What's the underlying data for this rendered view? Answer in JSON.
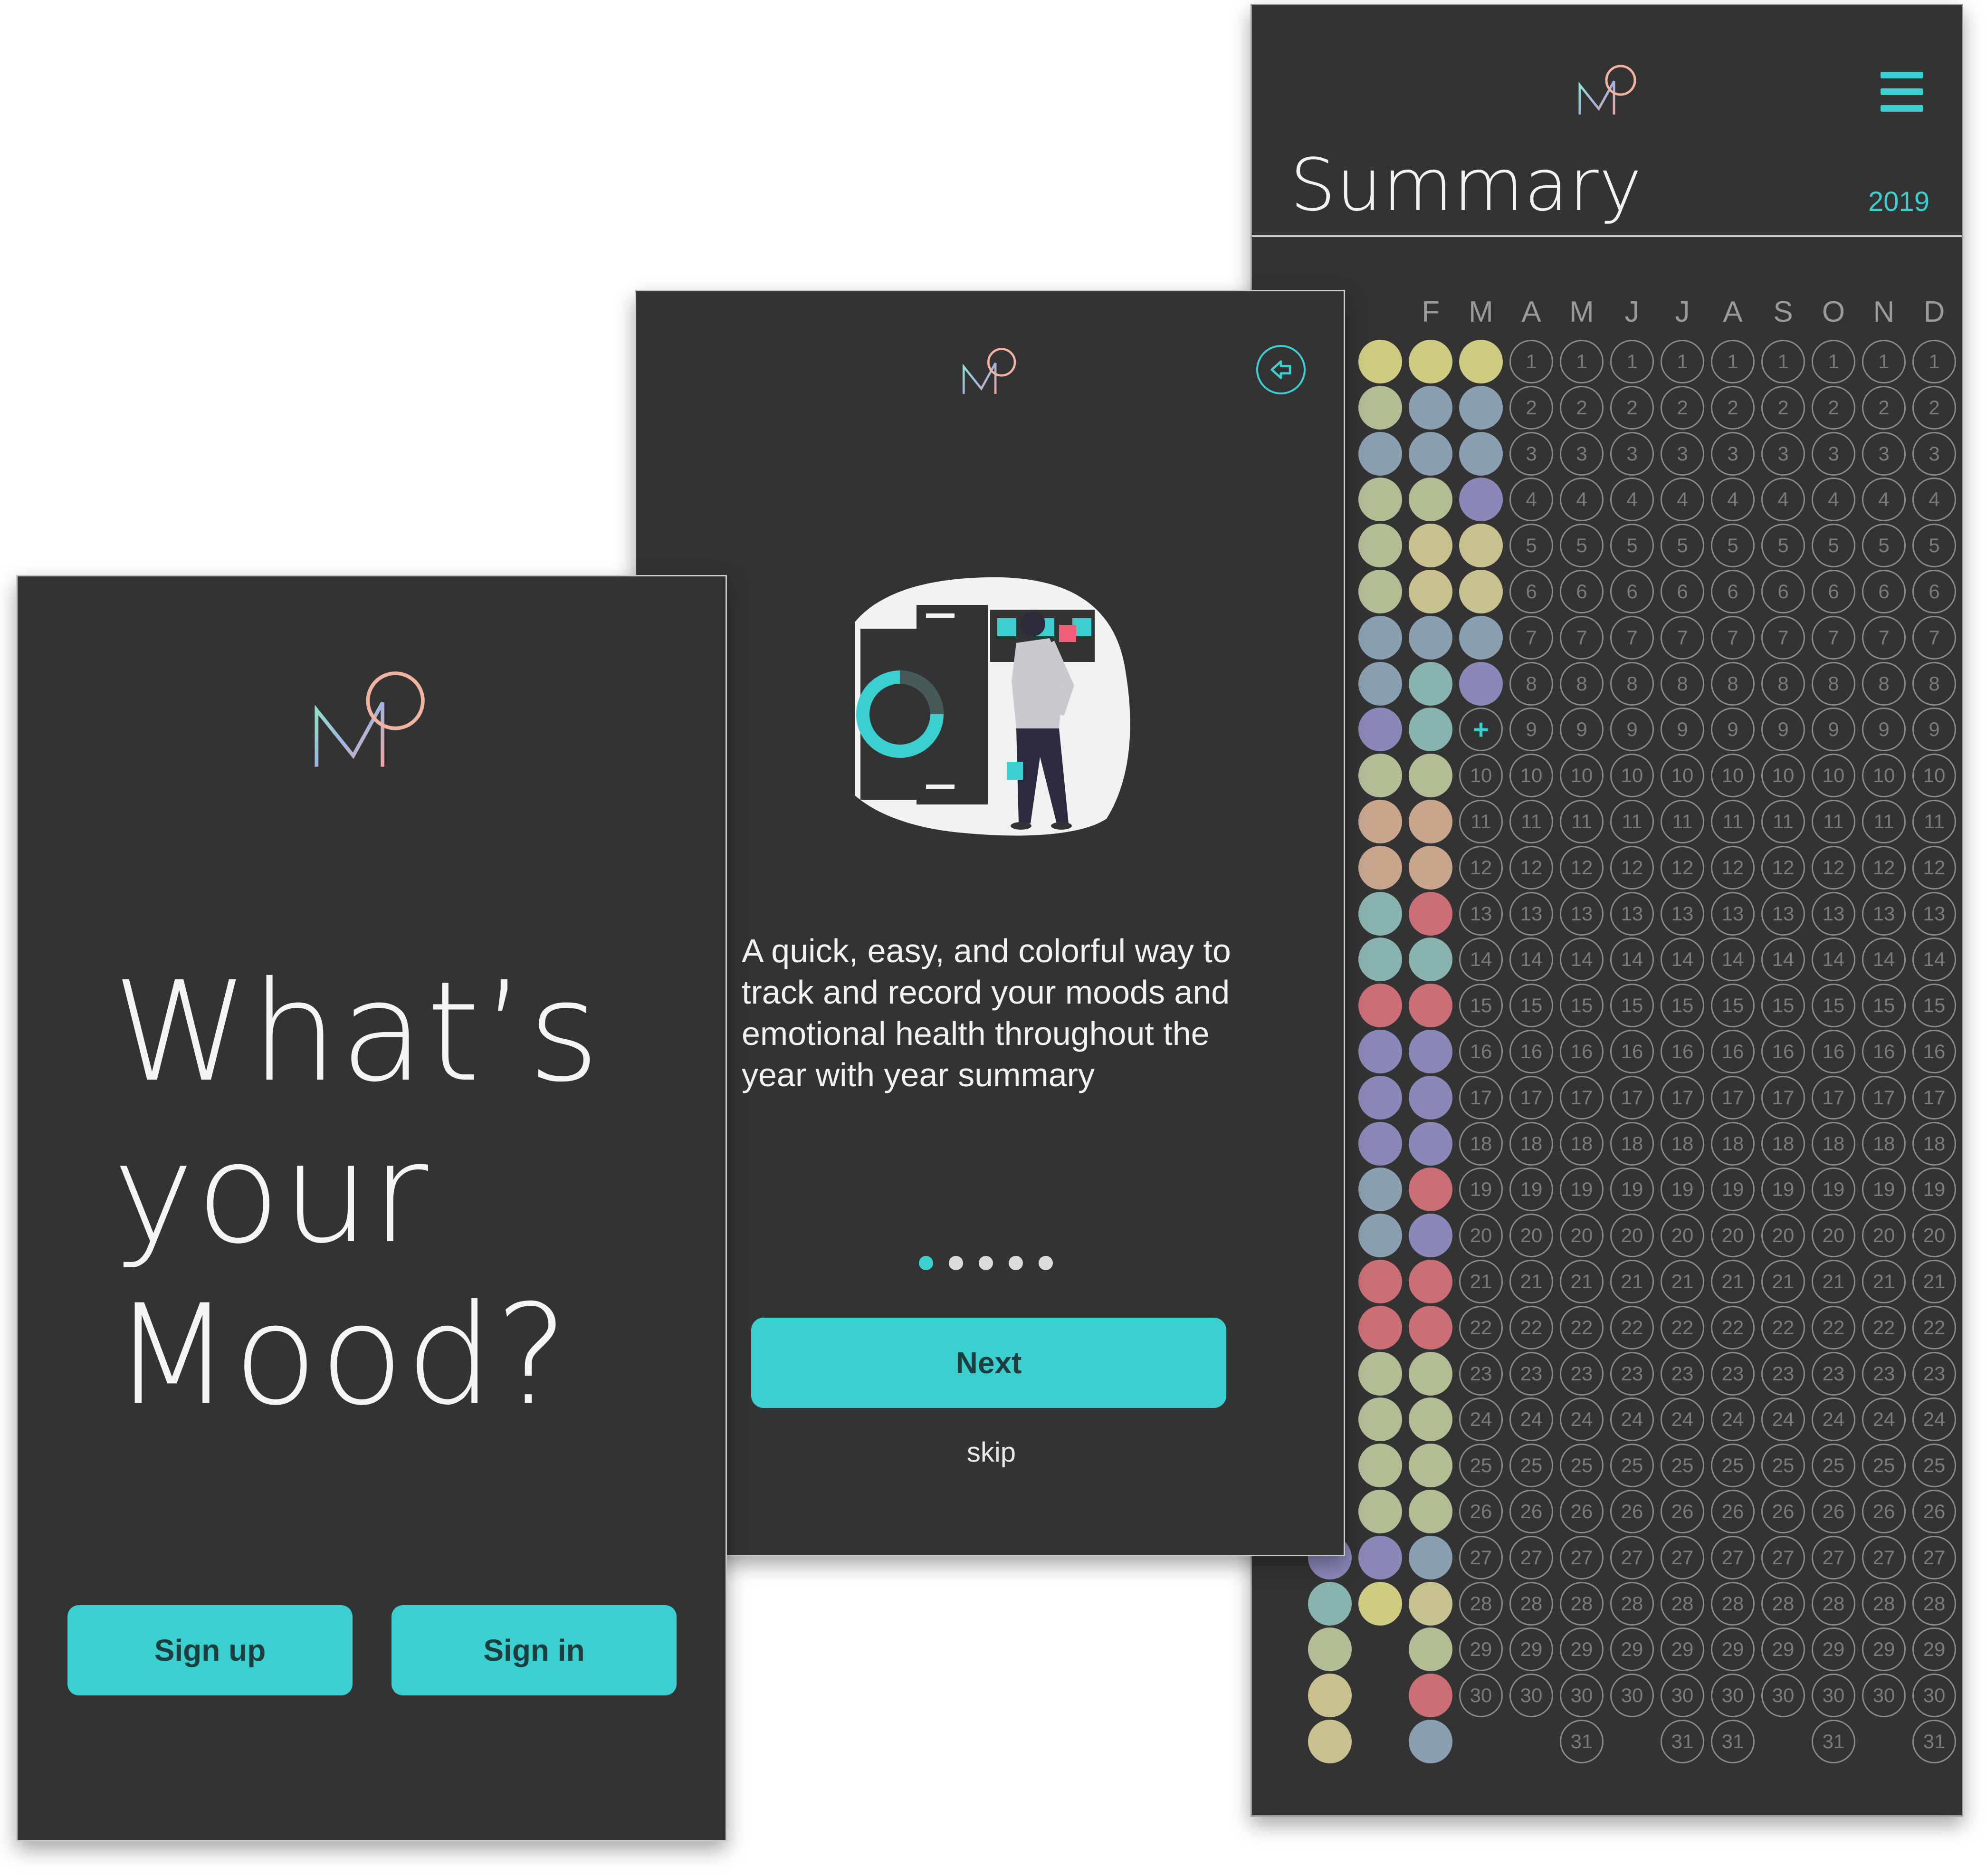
{
  "summary_screen": {
    "title": "Summary",
    "year": "2019",
    "menu_icon": "hamburger-menu-icon",
    "logo_icon": "mood-app-logo-icon",
    "months": [
      "F",
      "M",
      "A",
      "M",
      "J",
      "J",
      "A",
      "S",
      "O",
      "N",
      "D"
    ],
    "add_entry_symbol": "+",
    "mood_colors": {
      "yellow": "#cfcb83",
      "sage": "#b2bd96",
      "blue": "#8a9fb2",
      "purple": "#8a88b8",
      "peach": "#c9a58e",
      "teal": "#88b3ae",
      "red": "#cc6e76",
      "tan": "#c8c08e"
    },
    "month_moods": [
      [
        "yellow",
        "sage",
        "blue",
        "sage",
        "sage",
        "sage",
        "blue",
        "blue",
        "purple",
        "sage",
        "peach",
        "peach",
        "teal",
        "teal",
        "red",
        "purple",
        "purple",
        "purple",
        "blue",
        "blue",
        "red",
        "red",
        "sage",
        "sage",
        "sage",
        "sage",
        "purple",
        "yellow"
      ],
      [
        "yellow",
        "blue",
        "blue",
        "sage",
        "tan",
        "tan",
        "blue",
        "teal",
        "teal",
        "sage",
        "peach",
        "peach",
        "red",
        "teal",
        "red",
        "purple",
        "purple",
        "purple",
        "red",
        "purple",
        "red",
        "red",
        "sage",
        "sage",
        "sage",
        "sage",
        "blue",
        "tan",
        "sage",
        "red",
        "blue"
      ],
      [
        "yellow",
        "blue",
        "blue",
        "purple",
        "tan",
        "tan",
        "blue",
        "purple"
      ]
    ],
    "april_add_day": 9,
    "month_lengths": [
      31,
      30,
      31,
      30,
      31,
      31,
      30,
      31,
      30,
      31
    ],
    "accent_color": "#3bcfcf"
  },
  "onboarding_screen": {
    "logo_icon": "mood-app-logo-icon",
    "back_icon": "back-arrow-icon",
    "illustration": "person-viewing-charts-illustration",
    "description": "A quick, easy, and colorful way to track and record your moods and emotional health throughout the year with year summary",
    "page_dots": 5,
    "active_dot": 0,
    "next_label": "Next",
    "skip_label": "skip"
  },
  "welcome_screen": {
    "logo_icon": "mood-app-logo-icon",
    "headline_lines": [
      "What’s",
      "your",
      "Mood?"
    ],
    "signup_label": "Sign up",
    "signin_label": "Sign in"
  }
}
